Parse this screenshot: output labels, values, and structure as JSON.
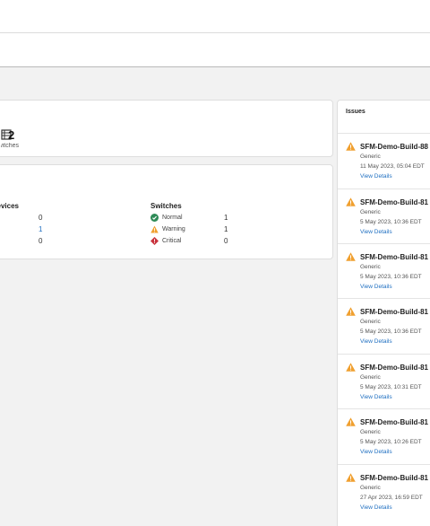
{
  "summary": {
    "total_count": "2",
    "total_sub_label": "Switches"
  },
  "status": {
    "devices_header": "Devices",
    "switches_header": "Switches",
    "devices_values": [
      "0",
      "1",
      "0"
    ],
    "switches": [
      {
        "label": "Normal",
        "value": "1",
        "icon": "check-circle-icon",
        "color": "#2e8b57"
      },
      {
        "label": "Warning",
        "value": "1",
        "icon": "warning-triangle-icon",
        "color": "#f0a030"
      },
      {
        "label": "Critical",
        "value": "0",
        "icon": "critical-diamond-icon",
        "color": "#c8323c"
      }
    ]
  },
  "issues": {
    "title": "Issues",
    "items": [
      {
        "name": "SFM-Demo-Build-88",
        "type": "Generic",
        "date": "11 May 2023, 05:04 EDT",
        "link": "View Details"
      },
      {
        "name": "SFM-Demo-Build-81",
        "type": "Generic",
        "date": "5 May 2023, 10:36 EDT",
        "link": "View Details"
      },
      {
        "name": "SFM-Demo-Build-81",
        "type": "Generic",
        "date": "5 May 2023, 10:36 EDT",
        "link": "View Details"
      },
      {
        "name": "SFM-Demo-Build-81",
        "type": "Generic",
        "date": "5 May 2023, 10:36 EDT",
        "link": "View Details"
      },
      {
        "name": "SFM-Demo-Build-81",
        "type": "Generic",
        "date": "5 May 2023, 10:31 EDT",
        "link": "View Details"
      },
      {
        "name": "SFM-Demo-Build-81",
        "type": "Generic",
        "date": "5 May 2023, 10:26 EDT",
        "link": "View Details"
      },
      {
        "name": "SFM-Demo-Build-81",
        "type": "Generic",
        "date": "27 Apr 2023, 16:59 EDT",
        "link": "View Details"
      }
    ]
  },
  "colors": {
    "link": "#1f6fc1",
    "warning": "#f0a030"
  }
}
